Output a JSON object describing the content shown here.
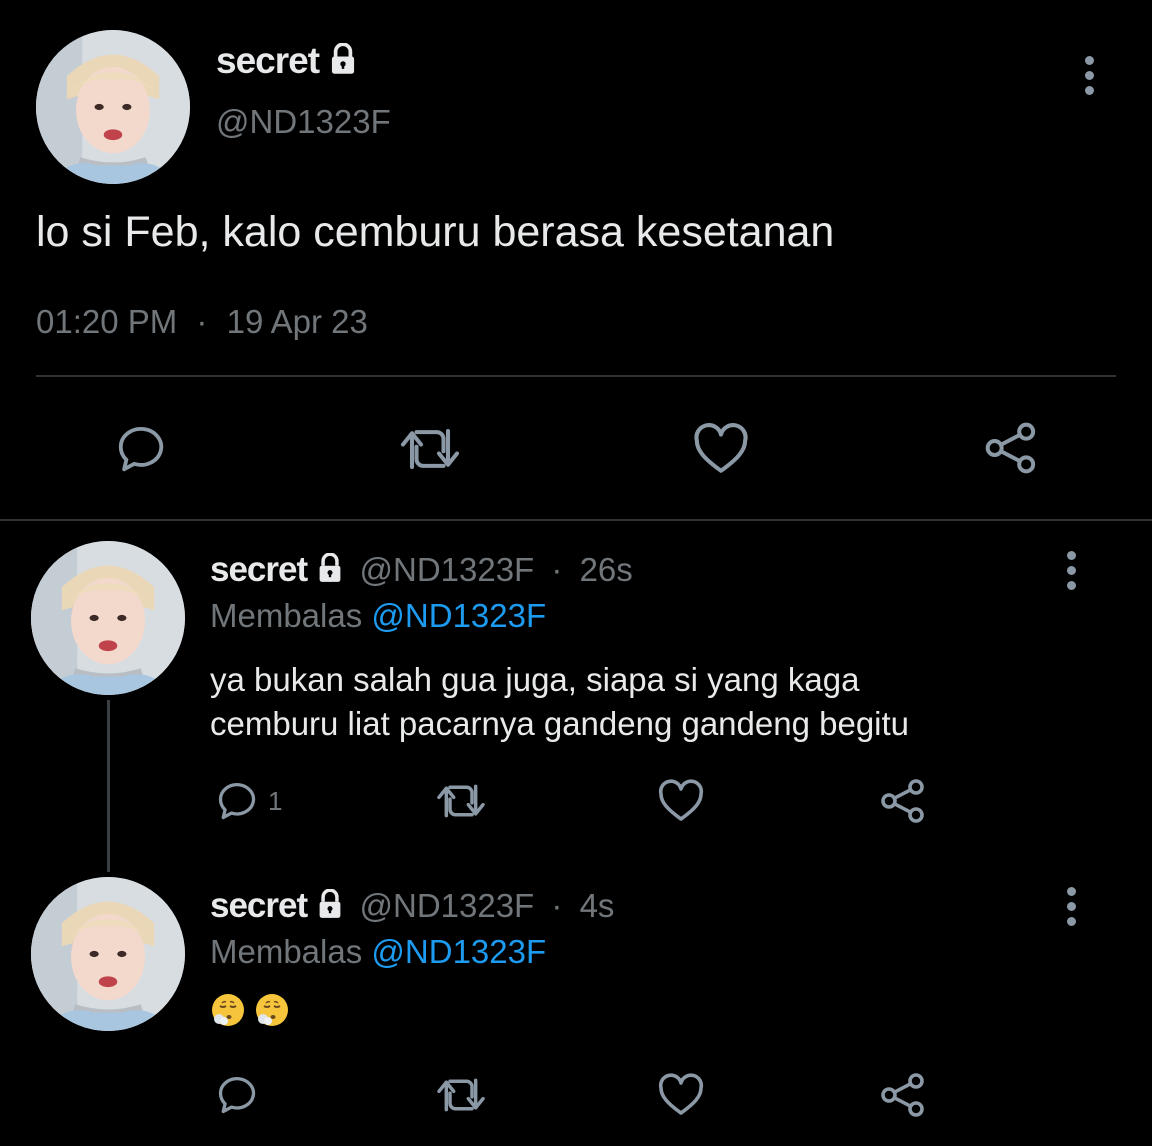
{
  "main_tweet": {
    "display_name": "secret",
    "handle": "@ND1323F",
    "text": "lo si Feb, kalo cemburu berasa kesetanan",
    "time": "01:20 PM",
    "dot": "·",
    "date": "19 Apr 23"
  },
  "replies": [
    {
      "display_name": "secret",
      "handle": "@ND1323F",
      "dot": "·",
      "age": "26s",
      "replying_prefix": "Membalas",
      "replying_to": "@ND1323F",
      "text_line1": "ya bukan salah gua juga, siapa si yang kaga",
      "text_line2": "cemburu liat pacarnya gandeng gandeng begitu",
      "reply_count": "1"
    },
    {
      "display_name": "secret",
      "handle": "@ND1323F",
      "dot": "·",
      "age": "4s",
      "replying_prefix": "Membalas",
      "replying_to": "@ND1323F",
      "emoji_text": "😮‍💨😮‍💨",
      "reply_count": ""
    }
  ],
  "icons": [
    "lock-icon",
    "more-icon",
    "reply-icon",
    "retweet-icon",
    "like-icon",
    "share-icon"
  ],
  "colors": {
    "background": "#000000",
    "text": "#e7e9ea",
    "muted": "#71767b",
    "link": "#1d9bf0",
    "divider": "#2f3336"
  }
}
